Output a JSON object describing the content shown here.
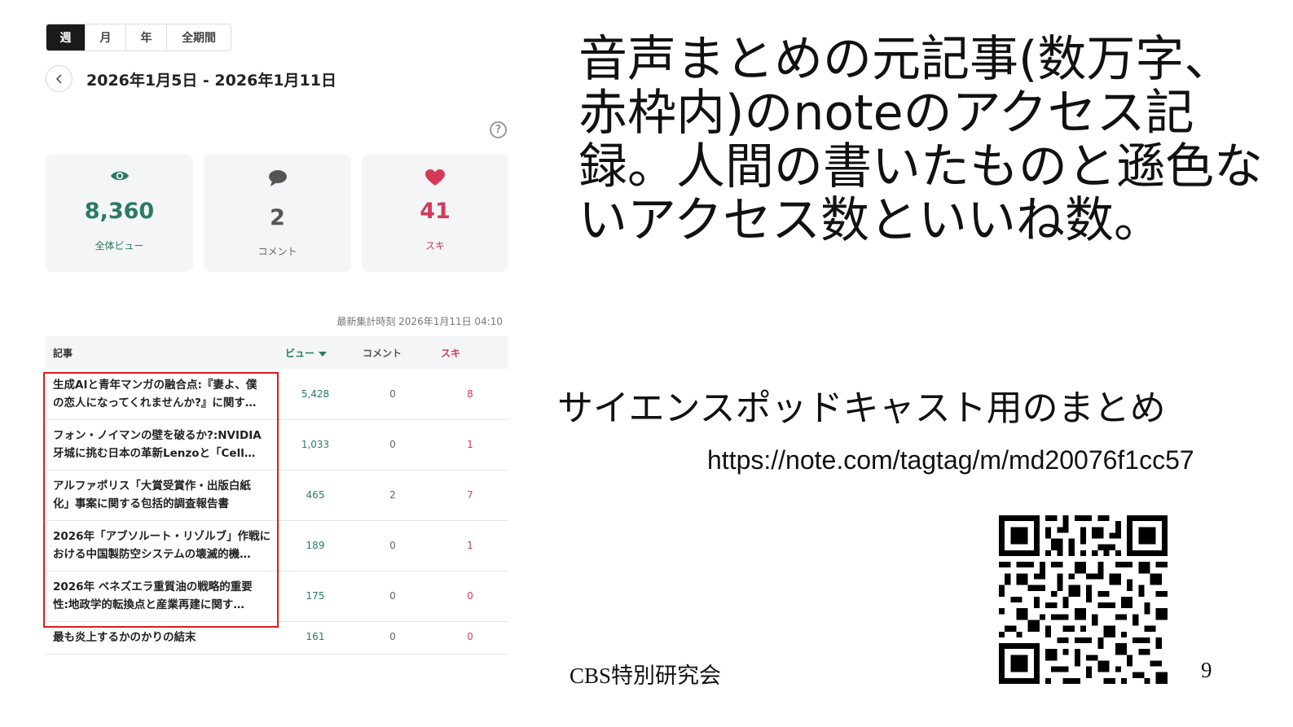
{
  "period_tabs": [
    "週",
    "月",
    "年",
    "全期間"
  ],
  "active_tab": "週",
  "date_range": "2026年1月5日 - 2026年1月11日",
  "stats": {
    "views": {
      "value": "8,360",
      "label": "全体ビュー",
      "icon": "eye-icon",
      "color": "#2a7a66"
    },
    "comments": {
      "value": "2",
      "label": "コメント",
      "icon": "speech-bubble-icon",
      "color": "#555555"
    },
    "likes": {
      "value": "41",
      "label": "スキ",
      "icon": "heart-icon",
      "color": "#d43a58"
    }
  },
  "last_updated": "最新集計時刻 2026年1月11日 04:10",
  "table": {
    "headers": {
      "article": "記事",
      "views": "ビュー",
      "comments": "コメント",
      "likes": "スキ"
    },
    "rows": [
      {
        "title1": "生成AIと青年マンガの融合点:『妻よ、僕",
        "title2": "の恋人になってくれませんか?』に関す…",
        "views": "5,428",
        "comments": "0",
        "likes": "8"
      },
      {
        "title1": "フォン・ノイマンの壁を破るか?:NVIDIA",
        "title2": "牙城に挑む日本の革新Lenzoと「Cell…",
        "views": "1,033",
        "comments": "0",
        "likes": "1"
      },
      {
        "title1": "アルファポリス「大賞受賞作・出版白紙",
        "title2": "化」事案に関する包括的調査報告書",
        "views": "465",
        "comments": "2",
        "likes": "7"
      },
      {
        "title1": "2026年「アブソルート・リゾルブ」作戦に",
        "title2": "おける中国製防空システムの壊滅的機…",
        "views": "189",
        "comments": "0",
        "likes": "1"
      },
      {
        "title1": "2026年 ベネズエラ重質油の戦略的重要",
        "title2": "性:地政学的転換点と産業再建に関す…",
        "views": "175",
        "comments": "0",
        "likes": "0"
      },
      {
        "title1": "最も炎上するかのかりの結末",
        "title2": "",
        "views": "161",
        "comments": "0",
        "likes": "0"
      }
    ]
  },
  "headline": "音声まとめの元記事(数万字、赤枠内)のnoteのアクセス記録。人間の書いたものと遜色ないアクセス数といいね数。",
  "subheading": "サイエンスポッドキャスト用のまとめ",
  "url": "https://note.com/tagtag/m/md20076f1cc57",
  "footer_org": "CBS特別研究会",
  "page_number": "9",
  "colors": {
    "accent_green": "#2a7a66",
    "accent_red": "#d43a58",
    "highlight_border": "#e01a1a"
  }
}
